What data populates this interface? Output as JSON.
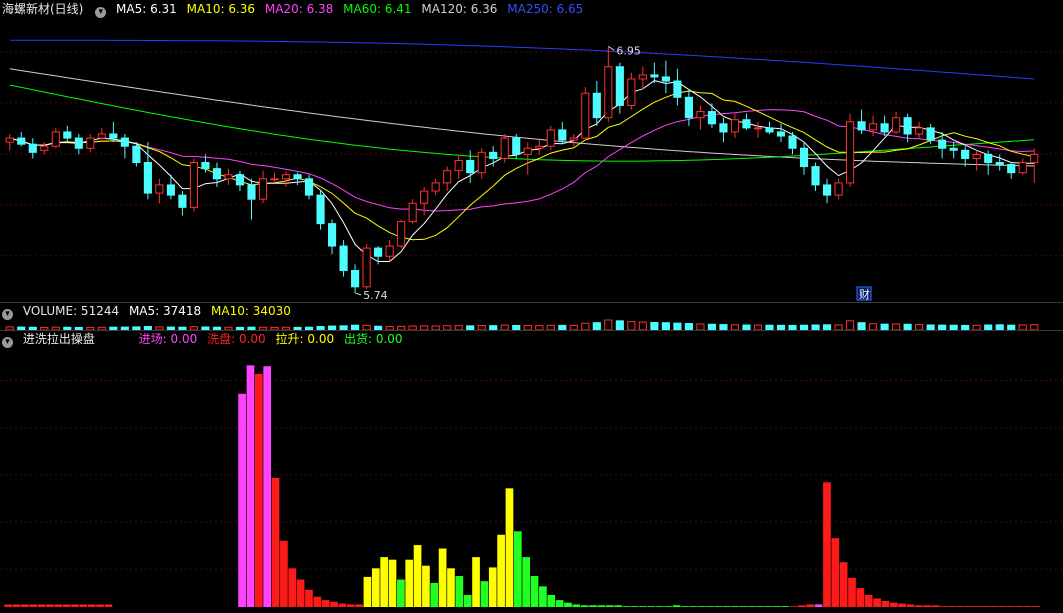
{
  "main": {
    "title": "海螺新材(日线)",
    "ma": [
      {
        "label": "MA5: 6.31",
        "color": "#ffffff"
      },
      {
        "label": "MA10: 6.36",
        "color": "#ffff00"
      },
      {
        "label": "MA20: 6.38",
        "color": "#ff44ff"
      },
      {
        "label": "MA60: 6.41",
        "color": "#00ff00"
      },
      {
        "label": "MA120: 6.36",
        "color": "#cfcfcf"
      },
      {
        "label": "MA250: 6.65",
        "color": "#2a3cff"
      }
    ],
    "high_label": "6.95",
    "low_label": "5.74",
    "event_badge": "财"
  },
  "volume": {
    "title": "VOLUME: 51244",
    "ma5": "MA5: 37418",
    "ma10": "MA10: 34030"
  },
  "indicator": {
    "title": "进洗拉出操盘",
    "items": [
      {
        "label": "进场:",
        "value": "0.00",
        "color": "#ff44ff"
      },
      {
        "label": "洗盘:",
        "value": "0.00",
        "color": "#ff2020"
      },
      {
        "label": "拉升:",
        "value": "0.00",
        "color": "#ffff00"
      },
      {
        "label": "出货:",
        "value": "0.00",
        "color": "#22ff22"
      }
    ]
  },
  "colors": {
    "up": "#ff3030",
    "down": "#4dfcff",
    "background": "#000000",
    "grid": "#5a0000"
  },
  "chart_data": {
    "type": "candlestick",
    "candles": [
      [
        6.48,
        6.52,
        6.44,
        6.5
      ],
      [
        6.5,
        6.53,
        6.46,
        6.47
      ],
      [
        6.47,
        6.5,
        6.4,
        6.43
      ],
      [
        6.44,
        6.48,
        6.42,
        6.46
      ],
      [
        6.46,
        6.55,
        6.45,
        6.53
      ],
      [
        6.53,
        6.56,
        6.48,
        6.5
      ],
      [
        6.5,
        6.52,
        6.42,
        6.45
      ],
      [
        6.45,
        6.52,
        6.43,
        6.5
      ],
      [
        6.5,
        6.55,
        6.48,
        6.52
      ],
      [
        6.52,
        6.58,
        6.48,
        6.5
      ],
      [
        6.5,
        6.52,
        6.4,
        6.46
      ],
      [
        6.46,
        6.48,
        6.36,
        6.38
      ],
      [
        6.38,
        6.48,
        6.2,
        6.23
      ],
      [
        6.23,
        6.3,
        6.18,
        6.27
      ],
      [
        6.27,
        6.32,
        6.2,
        6.22
      ],
      [
        6.22,
        6.24,
        6.12,
        6.16
      ],
      [
        6.16,
        6.4,
        6.14,
        6.38
      ],
      [
        6.38,
        6.42,
        6.33,
        6.35
      ],
      [
        6.35,
        6.38,
        6.26,
        6.3
      ],
      [
        6.3,
        6.35,
        6.27,
        6.32
      ],
      [
        6.32,
        6.34,
        6.24,
        6.27
      ],
      [
        6.27,
        6.3,
        6.1,
        6.2
      ],
      [
        6.2,
        6.34,
        6.18,
        6.3
      ],
      [
        6.3,
        6.33,
        6.28,
        6.3
      ],
      [
        6.3,
        6.34,
        6.26,
        6.32
      ],
      [
        6.32,
        6.33,
        6.27,
        6.3
      ],
      [
        6.3,
        6.32,
        6.2,
        6.22
      ],
      [
        6.22,
        6.24,
        6.05,
        6.08
      ],
      [
        6.08,
        6.1,
        5.93,
        5.97
      ],
      [
        5.97,
        6.0,
        5.82,
        5.85
      ],
      [
        5.85,
        5.88,
        5.74,
        5.77
      ],
      [
        5.77,
        5.98,
        5.76,
        5.96
      ],
      [
        5.96,
        5.97,
        5.88,
        5.92
      ],
      [
        5.92,
        6.0,
        5.9,
        5.97
      ],
      [
        5.97,
        6.1,
        5.96,
        6.09
      ],
      [
        6.09,
        6.2,
        6.08,
        6.18
      ],
      [
        6.18,
        6.26,
        6.12,
        6.24
      ],
      [
        6.24,
        6.3,
        6.22,
        6.28
      ],
      [
        6.28,
        6.36,
        6.24,
        6.34
      ],
      [
        6.34,
        6.42,
        6.3,
        6.39
      ],
      [
        6.39,
        6.44,
        6.28,
        6.33
      ],
      [
        6.33,
        6.45,
        6.3,
        6.43
      ],
      [
        6.43,
        6.46,
        6.36,
        6.4
      ],
      [
        6.4,
        6.52,
        6.38,
        6.5
      ],
      [
        6.5,
        6.52,
        6.4,
        6.42
      ],
      [
        6.42,
        6.48,
        6.32,
        6.45
      ],
      [
        6.45,
        6.49,
        6.42,
        6.46
      ],
      [
        6.46,
        6.56,
        6.44,
        6.54
      ],
      [
        6.54,
        6.58,
        6.47,
        6.49
      ],
      [
        6.49,
        6.52,
        6.46,
        6.5
      ],
      [
        6.5,
        6.75,
        6.49,
        6.72
      ],
      [
        6.72,
        6.78,
        6.56,
        6.6
      ],
      [
        6.6,
        6.95,
        6.58,
        6.85
      ],
      [
        6.85,
        6.87,
        6.62,
        6.66
      ],
      [
        6.66,
        6.82,
        6.64,
        6.79
      ],
      [
        6.79,
        6.85,
        6.74,
        6.81
      ],
      [
        6.81,
        6.87,
        6.77,
        6.8
      ],
      [
        6.8,
        6.88,
        6.72,
        6.78
      ],
      [
        6.78,
        6.84,
        6.66,
        6.7
      ],
      [
        6.7,
        6.74,
        6.56,
        6.6
      ],
      [
        6.6,
        6.66,
        6.54,
        6.63
      ],
      [
        6.63,
        6.67,
        6.55,
        6.57
      ],
      [
        6.57,
        6.6,
        6.48,
        6.53
      ],
      [
        6.53,
        6.62,
        6.5,
        6.59
      ],
      [
        6.59,
        6.62,
        6.54,
        6.55
      ],
      [
        6.55,
        6.58,
        6.5,
        6.55
      ],
      [
        6.55,
        6.58,
        6.52,
        6.53
      ],
      [
        6.53,
        6.57,
        6.48,
        6.51
      ],
      [
        6.51,
        6.53,
        6.42,
        6.45
      ],
      [
        6.45,
        6.48,
        6.32,
        6.36
      ],
      [
        6.36,
        6.38,
        6.24,
        6.27
      ],
      [
        6.27,
        6.3,
        6.18,
        6.22
      ],
      [
        6.22,
        6.3,
        6.2,
        6.28
      ],
      [
        6.28,
        6.62,
        6.26,
        6.58
      ],
      [
        6.58,
        6.64,
        6.52,
        6.54
      ],
      [
        6.54,
        6.61,
        6.51,
        6.57
      ],
      [
        6.57,
        6.61,
        6.51,
        6.53
      ],
      [
        6.53,
        6.63,
        6.52,
        6.6
      ],
      [
        6.6,
        6.62,
        6.48,
        6.52
      ],
      [
        6.52,
        6.58,
        6.5,
        6.55
      ],
      [
        6.55,
        6.57,
        6.47,
        6.49
      ],
      [
        6.49,
        6.53,
        6.4,
        6.45
      ],
      [
        6.45,
        6.48,
        6.4,
        6.44
      ],
      [
        6.44,
        6.46,
        6.36,
        6.4
      ],
      [
        6.4,
        6.44,
        6.34,
        6.42
      ],
      [
        6.42,
        6.44,
        6.32,
        6.38
      ],
      [
        6.38,
        6.42,
        6.34,
        6.37
      ],
      [
        6.37,
        6.38,
        6.3,
        6.33
      ],
      [
        6.33,
        6.4,
        6.32,
        6.38
      ],
      [
        6.38,
        6.45,
        6.28,
        6.42
      ]
    ],
    "volume": [
      30,
      28,
      26,
      25,
      27,
      26,
      24,
      25,
      26,
      27,
      28,
      30,
      34,
      30,
      28,
      27,
      32,
      29,
      27,
      26,
      25,
      27,
      26,
      25,
      26,
      25,
      27,
      34,
      38,
      40,
      46,
      44,
      36,
      33,
      35,
      38,
      40,
      39,
      41,
      42,
      40,
      43,
      42,
      47,
      44,
      43,
      42,
      45,
      44,
      44,
      65,
      70,
      96,
      88,
      80,
      76,
      72,
      70,
      66,
      62,
      58,
      55,
      52,
      50,
      48,
      47,
      46,
      45,
      44,
      46,
      48,
      50,
      48,
      88,
      70,
      60,
      56,
      58,
      55,
      52,
      48,
      47,
      46,
      44,
      45,
      48,
      50,
      46,
      48,
      51
    ],
    "ma_series_last": {
      "MA5": 6.31,
      "MA10": 6.36,
      "MA20": 6.38,
      "MA60": 6.41,
      "MA120": 6.36,
      "MA250": 6.65
    },
    "ylim": [
      5.72,
      7.05
    ],
    "indicator_series": {
      "bar_colors_by_group": [
        "magenta",
        "red",
        "yellow",
        "green"
      ],
      "values": [
        3,
        3,
        3,
        3,
        3,
        3,
        3,
        3,
        3,
        3,
        3,
        3,
        3,
        0,
        0,
        0,
        0,
        0,
        0,
        0,
        0,
        0,
        0,
        0,
        0,
        0,
        0,
        0,
        248,
        281,
        271,
        280,
        150,
        77,
        45,
        32,
        20,
        12,
        8,
        6,
        4,
        3,
        3,
        35,
        45,
        58,
        55,
        32,
        55,
        72,
        48,
        28,
        68,
        45,
        36,
        14,
        58,
        30,
        46,
        84,
        138,
        88,
        58,
        36,
        24,
        14,
        8,
        5,
        3,
        2,
        2,
        2,
        2,
        2,
        1,
        1,
        1,
        1,
        1,
        1,
        2,
        1,
        1,
        1,
        1,
        1,
        1,
        1,
        1,
        1,
        1,
        1,
        1,
        1,
        1,
        2,
        3,
        3,
        145,
        80,
        52,
        34,
        22,
        14,
        10,
        7,
        5,
        4,
        3,
        2,
        2,
        2,
        1,
        1,
        1,
        1,
        1,
        1,
        1,
        1,
        1,
        1,
        1,
        1
      ],
      "kinds": [
        "r",
        "r",
        "r",
        "r",
        "r",
        "r",
        "r",
        "r",
        "r",
        "r",
        "r",
        "r",
        "r",
        "r",
        "r",
        "r",
        "r",
        "r",
        "r",
        "r",
        "r",
        "r",
        "r",
        "r",
        "r",
        "r",
        "r",
        "r",
        "m",
        "m",
        "r",
        "m",
        "r",
        "r",
        "r",
        "r",
        "r",
        "r",
        "r",
        "r",
        "r",
        "r",
        "r",
        "y",
        "y",
        "y",
        "y",
        "g",
        "y",
        "y",
        "y",
        "g",
        "y",
        "y",
        "g",
        "g",
        "y",
        "g",
        "y",
        "y",
        "y",
        "g",
        "g",
        "g",
        "g",
        "g",
        "g",
        "g",
        "g",
        "g",
        "g",
        "g",
        "g",
        "g",
        "g",
        "g",
        "g",
        "g",
        "g",
        "g",
        "g",
        "g",
        "g",
        "g",
        "g",
        "g",
        "g",
        "g",
        "g",
        "g",
        "g",
        "g",
        "g",
        "g",
        "r",
        "r",
        "r",
        "m",
        "r",
        "r",
        "r",
        "r",
        "r",
        "r",
        "r",
        "r",
        "r",
        "r",
        "r",
        "r",
        "r",
        "r",
        "r",
        "r",
        "r",
        "r",
        "r",
        "r",
        "r",
        "r",
        "r",
        "r",
        "r",
        "r"
      ]
    }
  }
}
